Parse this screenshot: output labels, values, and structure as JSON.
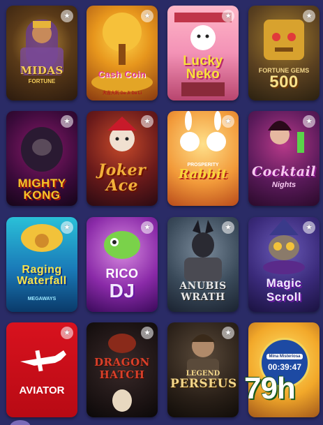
{
  "games": [
    {
      "id": "midas",
      "title": "MIDAS",
      "subtitle": "FORTUNE"
    },
    {
      "id": "cash-coin",
      "title": "Cash Coin",
      "subtitle": "大吉大利 Da Ji Da Li"
    },
    {
      "id": "lucky-neko",
      "title": "Lucky Neko",
      "subtitle": ""
    },
    {
      "id": "fortune-gems",
      "title": "FORTUNE GEMS",
      "subtitle": "500"
    },
    {
      "id": "mighty-kong",
      "title": "MIGHTY KONG",
      "subtitle": ""
    },
    {
      "id": "joker-ace",
      "title": "Joker Ace",
      "subtitle": ""
    },
    {
      "id": "prosperity-rabbit",
      "title": "Rabbit",
      "subtitle": "PROSPERITY"
    },
    {
      "id": "cocktail-nights",
      "title": "Cocktail",
      "subtitle": "Nights"
    },
    {
      "id": "raging-waterfall",
      "title": "Raging Waterfall",
      "subtitle": "MEGAWAYS"
    },
    {
      "id": "rico-dj",
      "title": "RICO",
      "subtitle": "DJ"
    },
    {
      "id": "anubis-wrath",
      "title": "ANUBIS",
      "subtitle": "WRATH"
    },
    {
      "id": "magic-scroll",
      "title": "Magic",
      "subtitle": "Scroll"
    },
    {
      "id": "aviator",
      "title": "AVIATOR",
      "subtitle": ""
    },
    {
      "id": "dragon-hatch",
      "title": "DRAGON",
      "subtitle": "HATCH"
    },
    {
      "id": "legend-perseus",
      "title": "PERSEUS",
      "subtitle": "LEGEND"
    },
    {
      "id": "mina-misteriosa",
      "title": "Mina Misteriosa",
      "subtitle": ""
    }
  ],
  "timer": {
    "label": "Mina Misteriosa",
    "value": "00:39:47"
  },
  "hours_overlay": "79h",
  "fav_icon": "star-icon",
  "colors": {
    "page_bg": "#2a2b66",
    "timer_blue": "#1d4aa3",
    "hours_green": "#1a5c1c"
  }
}
